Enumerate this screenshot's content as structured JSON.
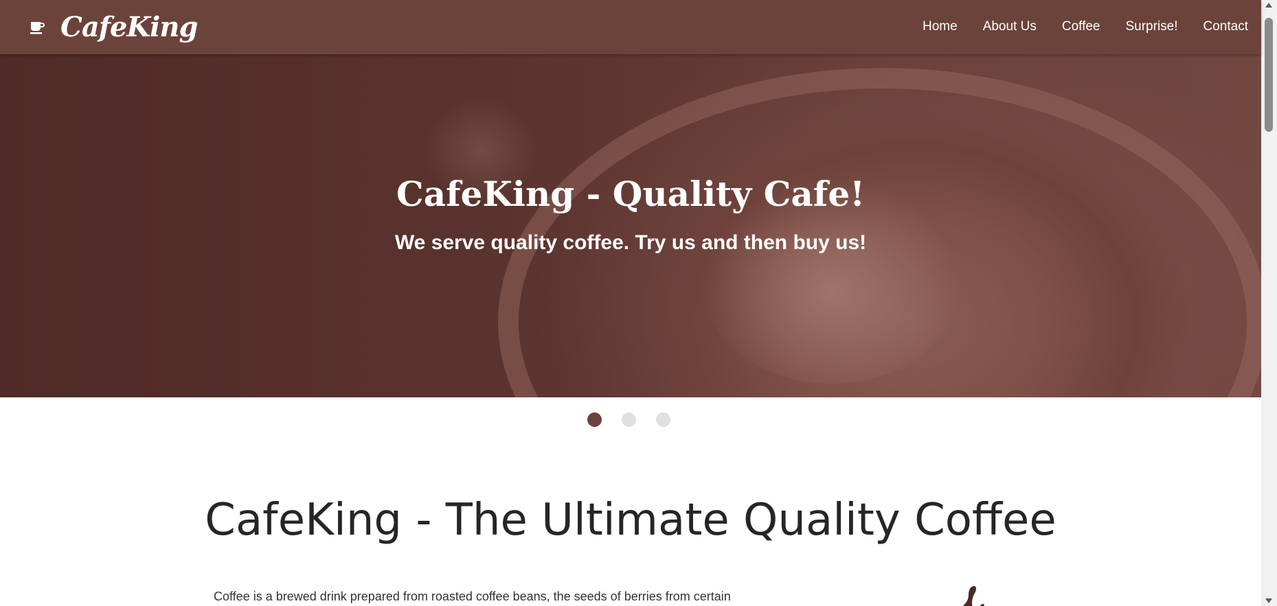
{
  "navbar": {
    "brand": {
      "icon": "coffee-cup-icon",
      "name": "CafeKing"
    },
    "links": [
      {
        "label": "Home"
      },
      {
        "label": "About Us"
      },
      {
        "label": "Coffee"
      },
      {
        "label": "Surprise!"
      },
      {
        "label": "Contact"
      }
    ],
    "background": "#6b433b"
  },
  "hero": {
    "title": "CafeKing - Quality Cafe!",
    "subtitle": "We serve quality coffee. Try us and then buy us!",
    "image": "latte-art-cup"
  },
  "carousel": {
    "slide_count": 3,
    "active_index": 0,
    "active_color": "#6b433b",
    "inactive_color": "#e0e0e0"
  },
  "main": {
    "title": "CafeKing - The Ultimate Quality Coffee",
    "intro": "Coffee is a brewed drink prepared from roasted coffee beans, the seeds of berries from certain",
    "side_icon": "coffee-steam-icon"
  }
}
